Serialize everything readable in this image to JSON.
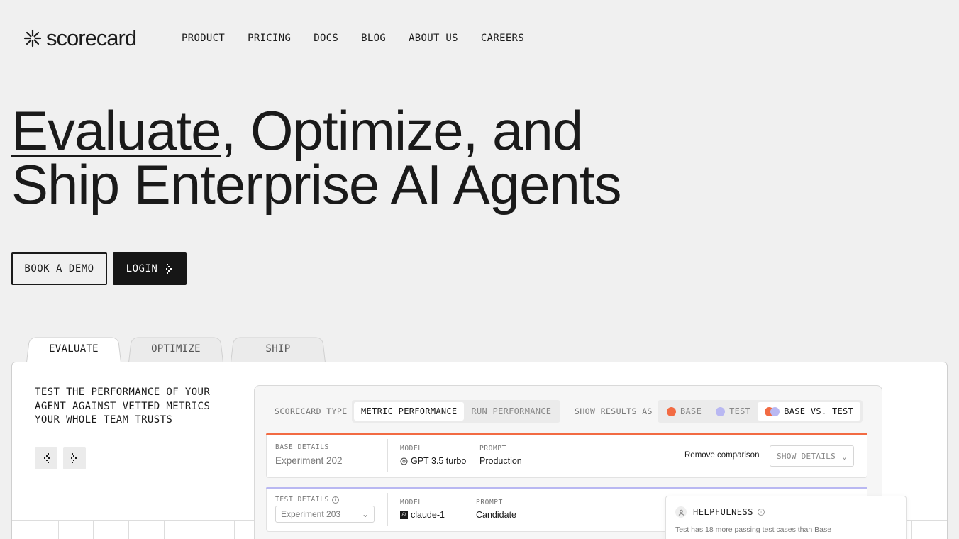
{
  "brand": {
    "name": "scorecard"
  },
  "nav": {
    "items": [
      "PRODUCT",
      "PRICING",
      "DOCS",
      "BLOG",
      "ABOUT US",
      "CAREERS"
    ]
  },
  "hero": {
    "line1_underlined": "Evaluate",
    "line1_rest": ", Optimize, and",
    "line2": "Ship Enterprise AI Agents"
  },
  "cta": {
    "demo": "BOOK A DEMO",
    "login": "LOGIN"
  },
  "tabs": [
    {
      "label": "EVALUATE",
      "active": true
    },
    {
      "label": "OPTIMIZE",
      "active": false
    },
    {
      "label": "SHIP",
      "active": false
    }
  ],
  "panel": {
    "description": "TEST THE PERFORMANCE OF YOUR AGENT AGAINST VETTED METRICS YOUR WHOLE TEAM TRUSTS"
  },
  "app": {
    "scorecard_type_label": "SCORECARD TYPE",
    "type_options": [
      "METRIC PERFORMANCE",
      "RUN PERFORMANCE"
    ],
    "show_results_label": "SHOW RESULTS AS",
    "result_options": [
      "BASE",
      "TEST",
      "BASE VS. TEST"
    ],
    "colors": {
      "base": "#f26b43",
      "test": "#b9b8f2"
    },
    "base": {
      "details_label": "BASE DETAILS",
      "experiment": "Experiment 202",
      "model_label": "MODEL",
      "model": "GPT 3.5 turbo",
      "prompt_label": "PROMPT",
      "prompt": "Production",
      "remove": "Remove comparison",
      "show_details": "SHOW DETAILS"
    },
    "test": {
      "details_label": "TEST DETAILS",
      "experiment": "Experiment 203",
      "model_label": "MODEL",
      "model": "claude-1",
      "prompt_label": "PROMPT",
      "prompt": "Candidate"
    },
    "helpfulness": {
      "title": "HELPFULNESS",
      "note": "Test has 18 more passing test cases than Base"
    }
  }
}
